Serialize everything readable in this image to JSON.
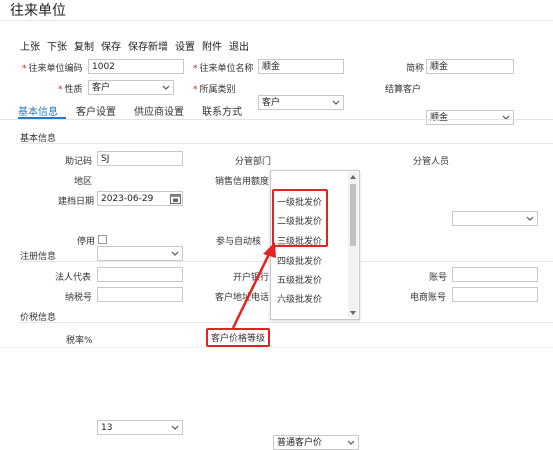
{
  "title": "往来单位",
  "toolbar": [
    "上张",
    "下张",
    "复制",
    "保存",
    "保存新增",
    "设置",
    "附件",
    "退出"
  ],
  "header": {
    "code_label": "往来单位编码",
    "code_value": "1002",
    "name_label": "往来单位名称",
    "name_value": "顺金",
    "short_label": "简称",
    "short_value": "顺金",
    "nature_label": "性质",
    "nature_value": "客户",
    "category_label": "所属类别",
    "category_value": "客户",
    "settle_label": "结算客户",
    "settle_value": "顺金"
  },
  "tabs": [
    "基本信息",
    "客户设置",
    "供应商设置",
    "联系方式"
  ],
  "basic": {
    "section_label": "基本信息",
    "mnemonic_label": "助记码",
    "mnemonic_value": "SJ",
    "dept_label": "分管部门",
    "dept_value": "",
    "staff_label": "分管人员",
    "staff_value": "",
    "region_label": "地区",
    "region_value": "",
    "credit_label": "销售信用额度",
    "date_label": "建档日期",
    "date_value": "2023-06-29",
    "disabled_label": "停用",
    "auto_label": "参与自动核"
  },
  "registration": {
    "section_label": "注册信息",
    "legal_label": "法人代表",
    "bank_label": "开户银行",
    "account_label": "账号",
    "tax_label": "纳税号",
    "addr_phone_label": "客户地址电话",
    "ebank_label": "电商账号"
  },
  "pricing": {
    "section_label": "价税信息",
    "tax_rate_label": "税率%",
    "tax_rate_value": "13",
    "price_level_label": "客户价格等级",
    "price_level_value": "普通客户价"
  },
  "dropdown": {
    "options": [
      "一级批发价",
      "二级批发价",
      "三级批发价",
      "四级批发价",
      "五级批发价",
      "六级批发价"
    ]
  },
  "colors": {
    "accent": "#2a79c7",
    "annotation": "#e52222",
    "required": "#e02020"
  }
}
